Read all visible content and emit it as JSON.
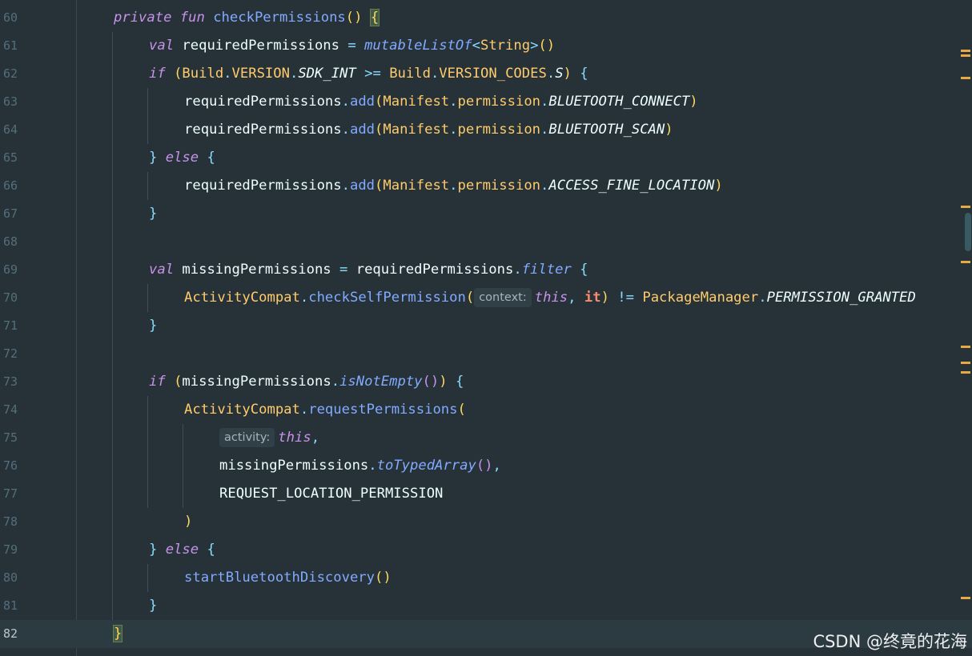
{
  "editor": {
    "lines": [
      {
        "n": "60",
        "segs": [
          [
            "kw",
            "private"
          ],
          [
            "pl",
            " "
          ],
          [
            "kw",
            "fun"
          ],
          [
            "pl",
            " "
          ],
          [
            "fn",
            "checkPermissions"
          ],
          [
            "br1",
            "()"
          ],
          [
            "pl",
            " "
          ],
          [
            "hl",
            "{"
          ]
        ]
      },
      {
        "n": "61",
        "segs": [
          [
            "kw",
            "val"
          ],
          [
            "pl",
            " requiredPermissions "
          ],
          [
            "op",
            "="
          ],
          [
            "pl",
            " "
          ],
          [
            "fni",
            "mutableListOf"
          ],
          [
            "op",
            "<"
          ],
          [
            "cls",
            "String"
          ],
          [
            "op",
            ">"
          ],
          [
            "br1",
            "()"
          ]
        ]
      },
      {
        "n": "62",
        "segs": [
          [
            "kw",
            "if"
          ],
          [
            "pl",
            " "
          ],
          [
            "br1",
            "("
          ],
          [
            "cls",
            "Build"
          ],
          [
            "op",
            "."
          ],
          [
            "cls",
            "VERSION"
          ],
          [
            "op",
            "."
          ],
          [
            "st",
            "SDK_INT"
          ],
          [
            "pl",
            " "
          ],
          [
            "op",
            ">="
          ],
          [
            "pl",
            " "
          ],
          [
            "cls",
            "Build"
          ],
          [
            "op",
            "."
          ],
          [
            "cls",
            "VERSION_CODES"
          ],
          [
            "op",
            "."
          ],
          [
            "st",
            "S"
          ],
          [
            "br1",
            ")"
          ],
          [
            "pl",
            " "
          ],
          [
            "op",
            "{"
          ]
        ]
      },
      {
        "n": "63",
        "segs": [
          [
            "pl",
            "requiredPermissions"
          ],
          [
            "op",
            "."
          ],
          [
            "fn",
            "add"
          ],
          [
            "br1",
            "("
          ],
          [
            "cls",
            "Manifest"
          ],
          [
            "op",
            "."
          ],
          [
            "cls",
            "permission"
          ],
          [
            "op",
            "."
          ],
          [
            "st",
            "BLUETOOTH_CONNECT"
          ],
          [
            "br1",
            ")"
          ]
        ]
      },
      {
        "n": "64",
        "segs": [
          [
            "pl",
            "requiredPermissions"
          ],
          [
            "op",
            "."
          ],
          [
            "fn",
            "add"
          ],
          [
            "br1",
            "("
          ],
          [
            "cls",
            "Manifest"
          ],
          [
            "op",
            "."
          ],
          [
            "cls",
            "permission"
          ],
          [
            "op",
            "."
          ],
          [
            "st",
            "BLUETOOTH_SCAN"
          ],
          [
            "br1",
            ")"
          ]
        ]
      },
      {
        "n": "65",
        "segs": [
          [
            "op",
            "}"
          ],
          [
            "pl",
            " "
          ],
          [
            "kw",
            "else"
          ],
          [
            "pl",
            " "
          ],
          [
            "op",
            "{"
          ]
        ]
      },
      {
        "n": "66",
        "segs": [
          [
            "pl",
            "requiredPermissions"
          ],
          [
            "op",
            "."
          ],
          [
            "fn",
            "add"
          ],
          [
            "br1",
            "("
          ],
          [
            "cls",
            "Manifest"
          ],
          [
            "op",
            "."
          ],
          [
            "cls",
            "permission"
          ],
          [
            "op",
            "."
          ],
          [
            "st",
            "ACCESS_FINE_LOCATION"
          ],
          [
            "br1",
            ")"
          ]
        ]
      },
      {
        "n": "67",
        "segs": [
          [
            "op",
            "}"
          ]
        ]
      },
      {
        "n": "68",
        "segs": []
      },
      {
        "n": "69",
        "segs": [
          [
            "kw",
            "val"
          ],
          [
            "pl",
            " missingPermissions "
          ],
          [
            "op",
            "="
          ],
          [
            "pl",
            " requiredPermissions"
          ],
          [
            "op",
            "."
          ],
          [
            "fni",
            "filter"
          ],
          [
            "pl",
            " "
          ],
          [
            "op",
            "{"
          ]
        ]
      },
      {
        "n": "70",
        "segs": [
          [
            "cls",
            "ActivityCompat"
          ],
          [
            "op",
            "."
          ],
          [
            "fn",
            "checkSelfPermission"
          ],
          [
            "br1",
            "("
          ],
          [
            "hint",
            "context:"
          ],
          [
            "kw",
            "this"
          ],
          [
            "op",
            ","
          ],
          [
            "pl",
            " "
          ],
          [
            "it",
            "it"
          ],
          [
            "br1",
            ")"
          ],
          [
            "pl",
            " "
          ],
          [
            "op",
            "!="
          ],
          [
            "pl",
            " "
          ],
          [
            "cls",
            "PackageManager"
          ],
          [
            "op",
            "."
          ],
          [
            "st",
            "PERMISSION_GRANTED"
          ]
        ]
      },
      {
        "n": "71",
        "segs": [
          [
            "op",
            "}"
          ]
        ]
      },
      {
        "n": "72",
        "segs": []
      },
      {
        "n": "73",
        "segs": [
          [
            "kw",
            "if"
          ],
          [
            "pl",
            " "
          ],
          [
            "br1",
            "("
          ],
          [
            "pl",
            "missingPermissions"
          ],
          [
            "op",
            "."
          ],
          [
            "fni",
            "isNotEmpty"
          ],
          [
            "br2",
            "()"
          ],
          [
            "br1",
            ")"
          ],
          [
            "pl",
            " "
          ],
          [
            "op",
            "{"
          ]
        ]
      },
      {
        "n": "74",
        "segs": [
          [
            "cls",
            "ActivityCompat"
          ],
          [
            "op",
            "."
          ],
          [
            "fn",
            "requestPermissions"
          ],
          [
            "br1",
            "("
          ]
        ]
      },
      {
        "n": "75",
        "segs": [
          [
            "hint",
            "activity:"
          ],
          [
            "kw",
            "this"
          ],
          [
            "op",
            ","
          ]
        ]
      },
      {
        "n": "76",
        "segs": [
          [
            "pl",
            "missingPermissions"
          ],
          [
            "op",
            "."
          ],
          [
            "fni",
            "toTypedArray"
          ],
          [
            "br2",
            "()"
          ],
          [
            "op",
            ","
          ]
        ]
      },
      {
        "n": "77",
        "segs": [
          [
            "pl",
            "REQUEST_LOCATION_PERMISSION"
          ]
        ]
      },
      {
        "n": "78",
        "segs": [
          [
            "br1",
            ")"
          ]
        ]
      },
      {
        "n": "79",
        "segs": [
          [
            "op",
            "}"
          ],
          [
            "pl",
            " "
          ],
          [
            "kw",
            "else"
          ],
          [
            "pl",
            " "
          ],
          [
            "op",
            "{"
          ]
        ]
      },
      {
        "n": "80",
        "segs": [
          [
            "fn",
            "startBluetoothDiscovery"
          ],
          [
            "br1",
            "()"
          ]
        ]
      },
      {
        "n": "81",
        "segs": [
          [
            "op",
            "}"
          ]
        ]
      },
      {
        "n": "82",
        "segs": [
          [
            "hl",
            "}"
          ]
        ]
      }
    ]
  },
  "watermark": "CSDN @终竟的花海",
  "colors": {
    "background": "#263238",
    "keyword": "#c792ea",
    "function": "#82aaff",
    "class": "#ffcb6b",
    "operator": "#89ddff",
    "error_stripe": "#e5a946"
  }
}
